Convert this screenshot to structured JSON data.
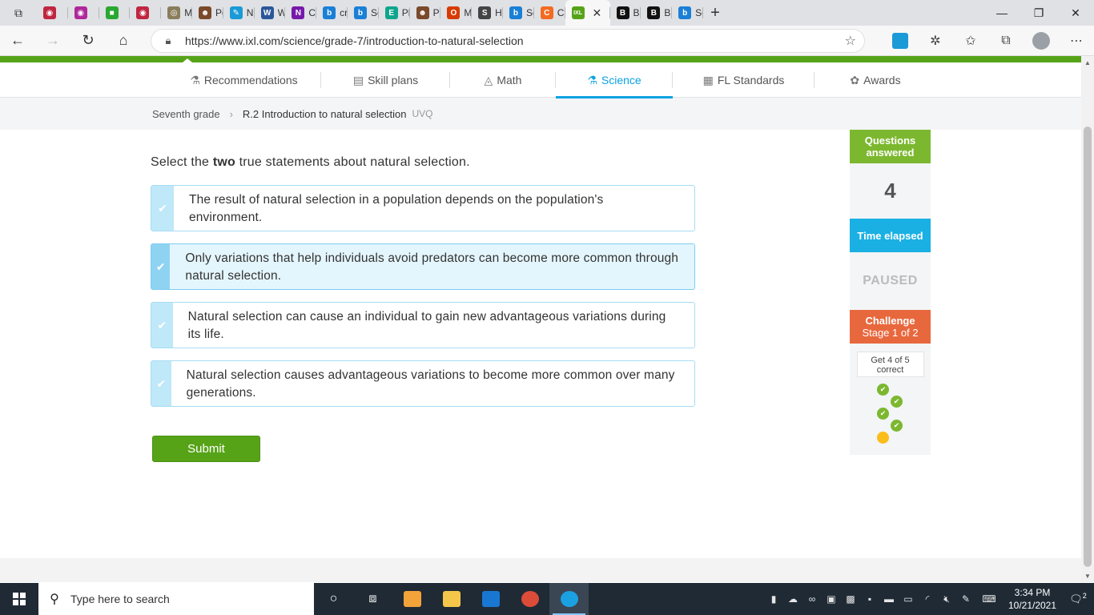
{
  "browser": {
    "tabs": [
      {
        "title": "",
        "color": "#c0263f",
        "glyph": "◉"
      },
      {
        "title": "",
        "color": "#b0279a",
        "glyph": "◉"
      },
      {
        "title": "",
        "color": "#2aa831",
        "glyph": "■"
      },
      {
        "title": "",
        "color": "#c0263f",
        "glyph": "◉"
      },
      {
        "title": "My",
        "color": "#8b7d5c",
        "glyph": "◎"
      },
      {
        "title": "Por",
        "color": "#7a4a2a",
        "glyph": "☻"
      },
      {
        "title": "Ne",
        "color": "#1a9ad7",
        "glyph": "✎"
      },
      {
        "title": "Wo",
        "color": "#2b579a",
        "glyph": "W"
      },
      {
        "title": "Cul",
        "color": "#7719aa",
        "glyph": "N"
      },
      {
        "title": "cro",
        "color": "#1a7fd6",
        "glyph": "b"
      },
      {
        "title": "Sea",
        "color": "#1a7fd6",
        "glyph": "b"
      },
      {
        "title": "Pho",
        "color": "#0fa58d",
        "glyph": "E"
      },
      {
        "title": "Por",
        "color": "#7a4a2a",
        "glyph": "☻"
      },
      {
        "title": "Mic",
        "color": "#d83b01",
        "glyph": "O"
      },
      {
        "title": "Ho",
        "color": "#444444",
        "glyph": "S"
      },
      {
        "title": "Sea",
        "color": "#1a7fd6",
        "glyph": "b"
      },
      {
        "title": "Che",
        "color": "#f26b21",
        "glyph": "C"
      },
      {
        "title": "",
        "color": "#56a318",
        "glyph": "IXL",
        "active": true
      },
      {
        "title": "Bra",
        "color": "#111111",
        "glyph": "B"
      },
      {
        "title": "Bra",
        "color": "#111111",
        "glyph": "B"
      },
      {
        "title": "Sea",
        "color": "#1a7fd6",
        "glyph": "b"
      }
    ],
    "url": "https://www.ixl.com/science/grade-7/introduction-to-natural-selection"
  },
  "topnav": {
    "items": [
      {
        "label": "Recommendations",
        "icon": "⚗"
      },
      {
        "label": "Skill plans",
        "icon": "▤"
      },
      {
        "label": "Math",
        "icon": "◬"
      },
      {
        "label": "Science",
        "icon": "⚗",
        "active": true
      },
      {
        "label": "FL Standards",
        "icon": "▦"
      },
      {
        "label": "Awards",
        "icon": "✿"
      }
    ]
  },
  "breadcrumb": {
    "grade": "Seventh grade",
    "skill": "R.2 Introduction to natural selection",
    "code": "UVQ"
  },
  "question": {
    "prefix": "Select the ",
    "emphasis": "two",
    "suffix": " true statements about natural selection.",
    "options": [
      {
        "text": "The result of natural selection in a population depends on the population's environment.",
        "selected": false
      },
      {
        "text": "Only variations that help individuals avoid predators can become more common through natural selection.",
        "selected": true
      },
      {
        "text": "Natural selection can cause an individual to gain new advantageous variations during its life.",
        "selected": false
      },
      {
        "text": "Natural selection causes advantageous variations to become more common over many generations.",
        "selected": false
      }
    ],
    "submit_label": "Submit"
  },
  "sidebar": {
    "questions_label": "Questions answered",
    "questions_count": "4",
    "time_label": "Time elapsed",
    "time_value": "PAUSED",
    "challenge_label": "Challenge",
    "challenge_stage": "Stage 1 of 2",
    "goal_text": "Get 4 of 5 correct",
    "progress": {
      "completed": 4,
      "total": 5
    }
  },
  "taskbar": {
    "search_placeholder": "Type here to search",
    "time": "3:34 PM",
    "date": "10/21/2021",
    "notifications": "2"
  }
}
